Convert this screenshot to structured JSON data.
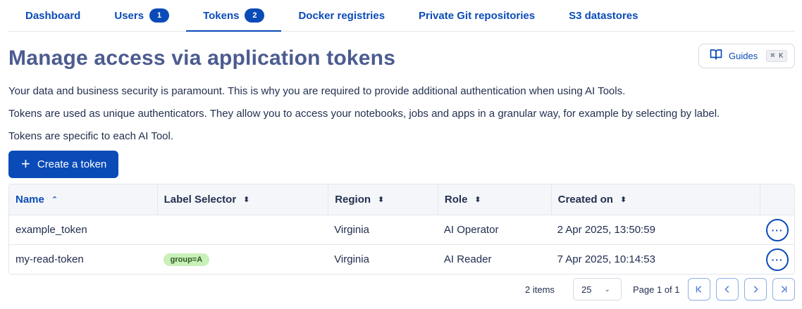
{
  "tabs": [
    {
      "label": "Dashboard"
    },
    {
      "label": "Users",
      "badge": "1"
    },
    {
      "label": "Tokens",
      "badge": "2",
      "active": true
    },
    {
      "label": "Docker registries"
    },
    {
      "label": "Private Git repositories"
    },
    {
      "label": "S3 datastores"
    }
  ],
  "header": {
    "title": "Manage access via application tokens",
    "guides_label": "Guides",
    "guides_shortcut": "⌘ K"
  },
  "intro": {
    "p1": "Your data and business security is paramount. This is why you are required to provide additional authentication when using AI Tools.",
    "p2": "Tokens are used as unique authenticators. They allow you to access your notebooks, jobs and apps in a granular way, for example by selecting by label.",
    "p3": "Tokens are specific to each AI Tool."
  },
  "create_button": {
    "label": "Create a token"
  },
  "table": {
    "columns": [
      "Name",
      "Label Selector",
      "Region",
      "Role",
      "Created on"
    ],
    "sorted_column": "Name",
    "rows": [
      {
        "name": "example_token",
        "label_selector": "",
        "region": "Virginia",
        "role": "AI Operator",
        "created_on": "2 Apr 2025, 13:50:59"
      },
      {
        "name": "my-read-token",
        "label_selector": "group=A",
        "region": "Virginia",
        "role": "AI Reader",
        "created_on": "7 Apr 2025, 10:14:53"
      }
    ]
  },
  "pagination": {
    "items_count": "2 items",
    "page_size": "25",
    "page_info": "Page 1 of 1"
  },
  "colors": {
    "accent": "#0b4bb8",
    "title": "#4c5b8f",
    "tag_bg": "#c9f0b9"
  }
}
